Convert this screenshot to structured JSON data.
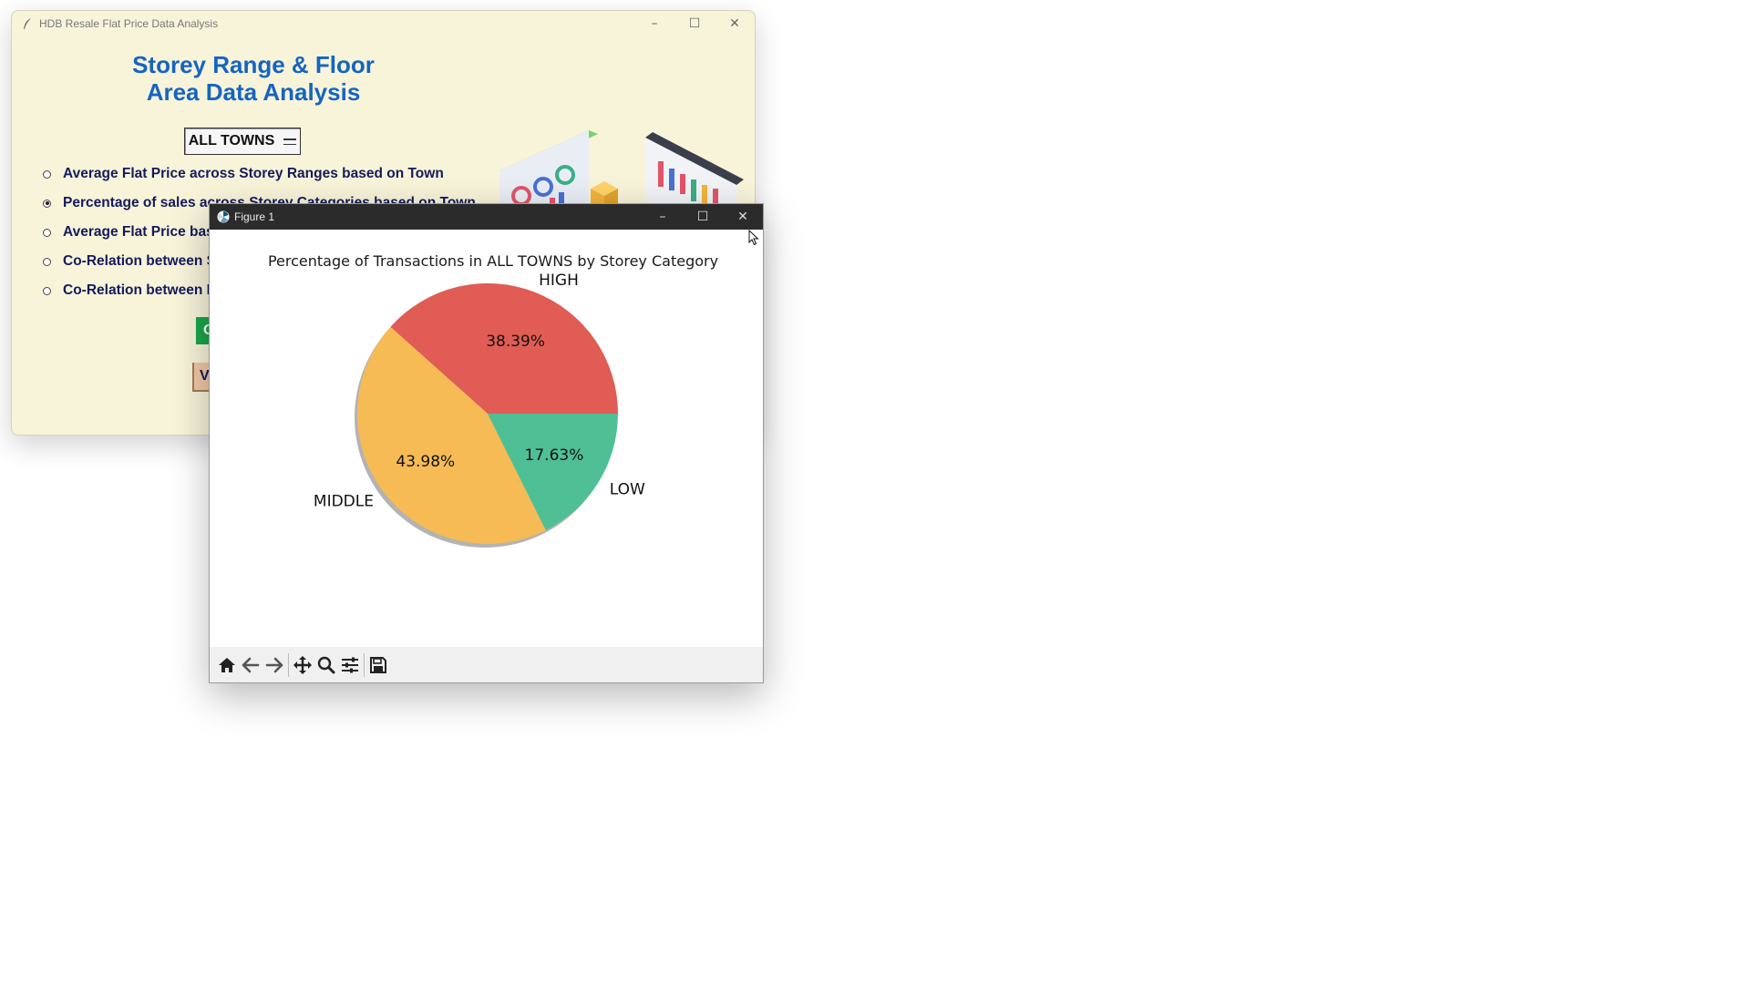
{
  "main_window": {
    "title": "HDB Resale Flat Price Data Analysis",
    "heading_line1": "Storey Range & Floor",
    "heading_line2": "Area Data Analysis",
    "town_select": {
      "value": "ALL TOWNS"
    },
    "radio_options": [
      {
        "label": "Average Flat Price across Storey Ranges based on Town",
        "checked": false
      },
      {
        "label": "Percentage of sales across Storey Categories based on Town",
        "checked": true
      },
      {
        "label": "Average Flat Price based",
        "checked": false
      },
      {
        "label": "Co-Relation between Sto",
        "checked": false
      },
      {
        "label": "Co-Relation between Flo",
        "checked": false
      }
    ],
    "generate_button_label": "Ge",
    "view_button_label": "Vie"
  },
  "figure_window": {
    "title": "Figure 1",
    "toolbar": [
      "home-icon",
      "back-icon",
      "forward-icon",
      "pan-icon",
      "zoom-icon",
      "configure-subplots-icon",
      "save-icon"
    ]
  },
  "window_controls": {
    "minimize": "–",
    "maximize": "☐",
    "close": "✕"
  },
  "colors": {
    "high": "#e05c55",
    "middle": "#f6bb55",
    "low": "#4fbf96"
  },
  "chart_data": {
    "type": "pie",
    "title": "Percentage of Transactions in ALL TOWNS by Storey Category",
    "slices": [
      {
        "label": "HIGH",
        "value": 38.39,
        "display": "38.39%"
      },
      {
        "label": "MIDDLE",
        "value": 43.98,
        "display": "43.98%"
      },
      {
        "label": "LOW",
        "value": 17.63,
        "display": "17.63%"
      }
    ],
    "start_angle_deg": 0,
    "direction": "counterclockwise",
    "shadow": true
  }
}
